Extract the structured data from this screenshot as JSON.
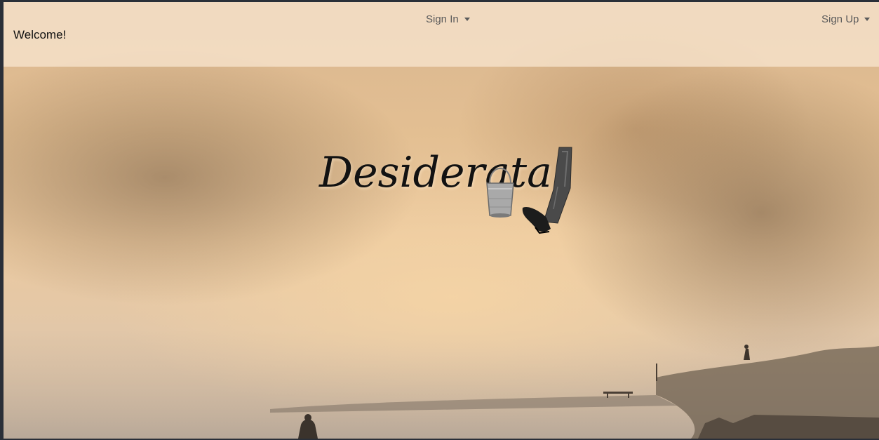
{
  "navbar": {
    "brand": "Welcome!",
    "sign_in_label": "Sign In",
    "sign_up_label": "Sign Up"
  },
  "hero": {
    "title": "Desiderata"
  },
  "icons": {
    "dropdown": "caret-down-icon",
    "logo_bucket": "bucket-icon",
    "logo_kick": "kicking-leg-icon"
  },
  "colors": {
    "navbar_bg": "#f7e4cd",
    "nav_text": "#5b5b5b",
    "brand_text": "#111111",
    "title_text": "#121212"
  }
}
